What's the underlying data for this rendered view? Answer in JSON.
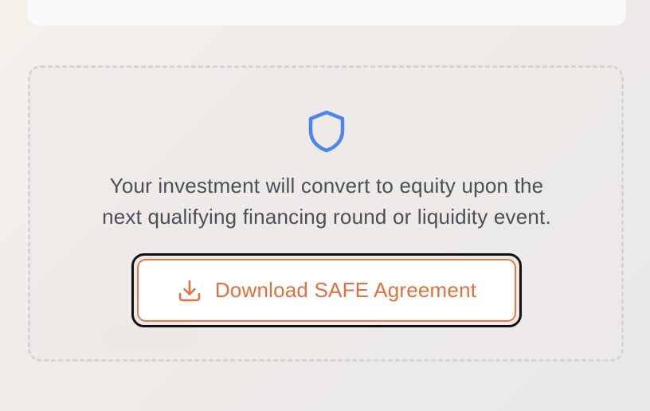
{
  "notice": {
    "line1": "Your investment will convert to equity upon the",
    "line2": "next qualifying financing round or liquidity event."
  },
  "download_button": {
    "label": "Download SAFE Agreement"
  },
  "icons": {
    "shield": "shield-icon",
    "download": "download-icon"
  },
  "colors": {
    "accent": "#e0703f",
    "shield": "#4d85ee",
    "text": "#4a4f59"
  }
}
